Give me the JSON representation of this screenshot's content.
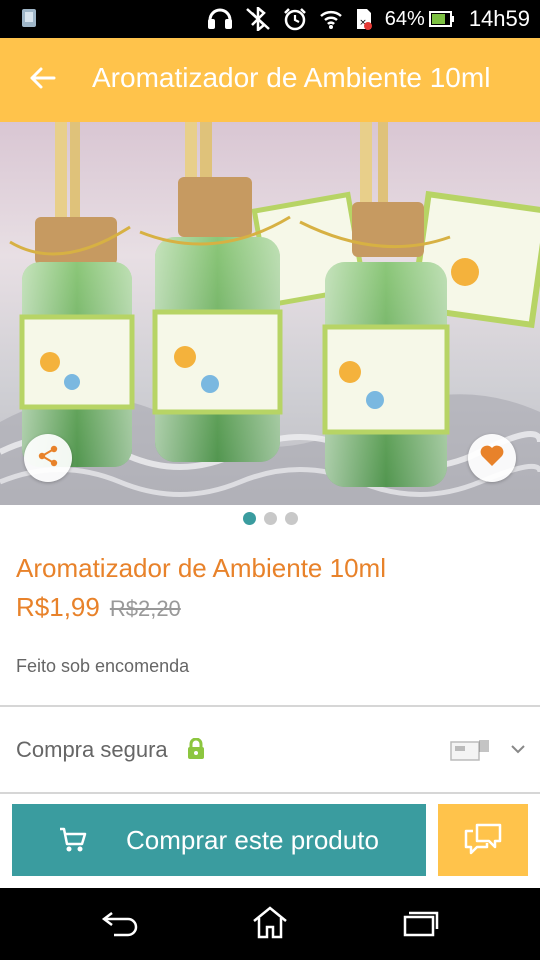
{
  "status_bar": {
    "battery_percent": "64%",
    "time": "14h59",
    "icons": [
      "notification-app-icon",
      "headset-icon",
      "bluetooth-icon",
      "alarm-icon",
      "wifi-icon",
      "no-sim-icon",
      "battery-icon"
    ]
  },
  "app_bar": {
    "title": "Aromatizador de Ambiente 10ml",
    "back_icon": "arrow-left-icon"
  },
  "gallery": {
    "image_count": 3,
    "active_index": 0,
    "share_icon": "share-icon",
    "favorite_icon": "heart-icon"
  },
  "product": {
    "title": "Aromatizador de Ambiente 10ml",
    "price": "R$1,99",
    "old_price": "R$2,20",
    "availability": "Feito sob encomenda"
  },
  "secure_purchase": {
    "label": "Compra segura",
    "lock_icon": "lock-icon",
    "payment_icon": "payment-slip-icon",
    "expand_icon": "chevron-down-icon"
  },
  "actions": {
    "buy_label": "Comprar este produto",
    "buy_icon": "cart-icon",
    "chat_icon": "chat-bubbles-icon"
  },
  "nav_bar": {
    "icons": [
      "back-nav-icon",
      "home-icon",
      "recents-icon"
    ]
  },
  "colors": {
    "accent_yellow": "#ffc34b",
    "teal": "#3a9c9f",
    "orange_text": "#e8822a",
    "lime_lock": "#8cc63f"
  }
}
